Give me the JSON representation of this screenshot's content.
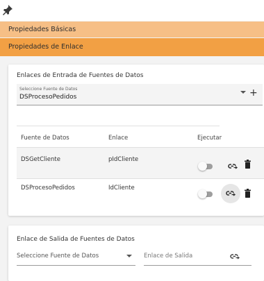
{
  "header": {
    "pin_icon": "pin-icon"
  },
  "sections": {
    "basic_label": "Propiedades Básicas",
    "link_label": "Propiedades de Enlace"
  },
  "input_links": {
    "title": "Enlaces de Entrada de Fuentes de Datos",
    "select": {
      "label": "Seleccione Fuente de Datos",
      "value": "DSProcesoPedidos"
    },
    "table": {
      "columns": [
        "Fuente de Datos",
        "Enlace",
        "Ejecutar"
      ],
      "rows": [
        {
          "source": "DSGetCliente",
          "link": "pIdCliente",
          "execute": false
        },
        {
          "source": "DSProcesoPedidos",
          "link": "IdCliente",
          "execute": false
        }
      ]
    }
  },
  "output_links": {
    "title": "Enlace de Salida de Fuentes de Datos",
    "select_placeholder": "Seleccione Fuente de Datos",
    "link_placeholder": "Enlace de Salida"
  },
  "colors": {
    "section_basic": "#f6bf86",
    "section_link": "#f2a044"
  }
}
